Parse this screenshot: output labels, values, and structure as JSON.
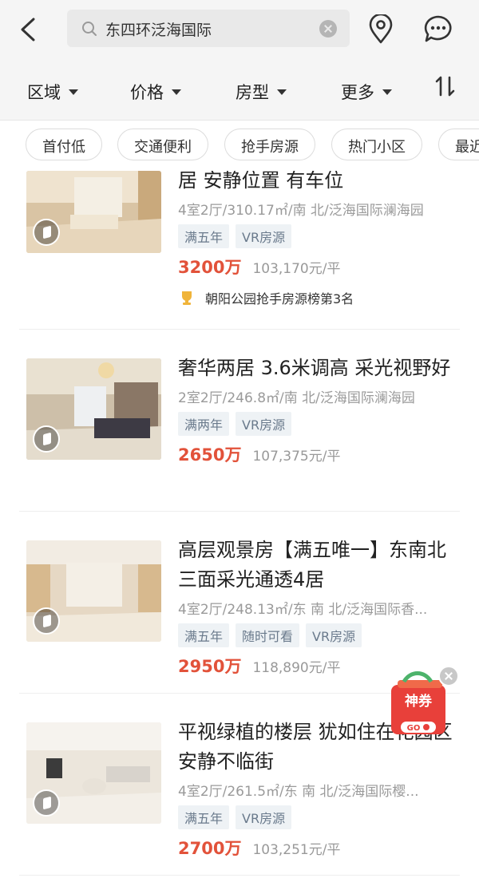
{
  "search": {
    "query": "东四环泛海国际"
  },
  "filters": [
    "区域",
    "价格",
    "房型",
    "更多"
  ],
  "chips": [
    "首付低",
    "交通便利",
    "抢手房源",
    "热门小区",
    "最近"
  ],
  "listings": [
    {
      "title": "居 安静位置 有车位",
      "meta": "4室2厅/310.17㎡/南 北/泛海国际澜海园",
      "tags": [
        "满五年",
        "VR房源"
      ],
      "price": "3200万",
      "unit_price": "103,170元/平",
      "rank": "朝阳公园抢手房源榜第3名"
    },
    {
      "title": "奢华两居 3.6米调高 采光视野好",
      "meta": "2室2厅/246.8㎡/南 北/泛海国际澜海园",
      "tags": [
        "满两年",
        "VR房源"
      ],
      "price": "2650万",
      "unit_price": "107,375元/平"
    },
    {
      "title": "高层观景房【满五唯一】东南北三面采光通透4居",
      "meta": "4室2厅/248.13㎡/东 南 北/泛海国际香...",
      "tags": [
        "满五年",
        "随时可看",
        "VR房源"
      ],
      "price": "2950万",
      "unit_price": "118,890元/平"
    },
    {
      "title": "平视绿植的楼层 犹如住在花园区 安静不临街",
      "meta": "4室2厅/261.5㎡/东 南 北/泛海国际樱...",
      "tags": [
        "满五年",
        "VR房源"
      ],
      "price": "2700万",
      "unit_price": "103,251元/平"
    }
  ],
  "coupon": {
    "label": "神券",
    "go": "GO"
  },
  "colors": {
    "price": "#e2523a",
    "tag_bg": "#eef2f5",
    "tag_text": "#6a7a8c",
    "header_bg": "#f5f5f5"
  }
}
